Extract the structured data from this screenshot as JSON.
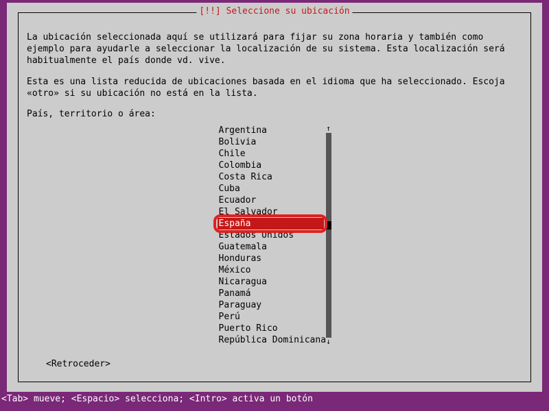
{
  "dialog": {
    "title": "[!!] Seleccione su ubicación",
    "desc1": "La ubicación seleccionada aquí se utilizará para fijar su zona horaria y también como ejemplo para ayudarle a seleccionar la localización de su sistema. Esta localización será habitualmente el país donde vd. vive.",
    "desc2": "Esta es una lista reducida de ubicaciones basada en el idioma que ha seleccionado. Escoja «otro» si su ubicación no está en la lista.",
    "prompt": "País, territorio o área:",
    "back_label": "<Retroceder>"
  },
  "countries": [
    "Argentina",
    "Bolivia",
    "Chile",
    "Colombia",
    "Costa Rica",
    "Cuba",
    "Ecuador",
    "El Salvador",
    "España",
    "Estados Unidos",
    "Guatemala",
    "Honduras",
    "México",
    "Nicaragua",
    "Panamá",
    "Paraguay",
    "Perú",
    "Puerto Rico",
    "República Dominicana"
  ],
  "selected_index": 8,
  "scroll": {
    "top_arrow": "↑",
    "bottom_arrow": "↓"
  },
  "statusbar": "<Tab> mueve; <Espacio> selecciona; <Intro> activa un botón"
}
